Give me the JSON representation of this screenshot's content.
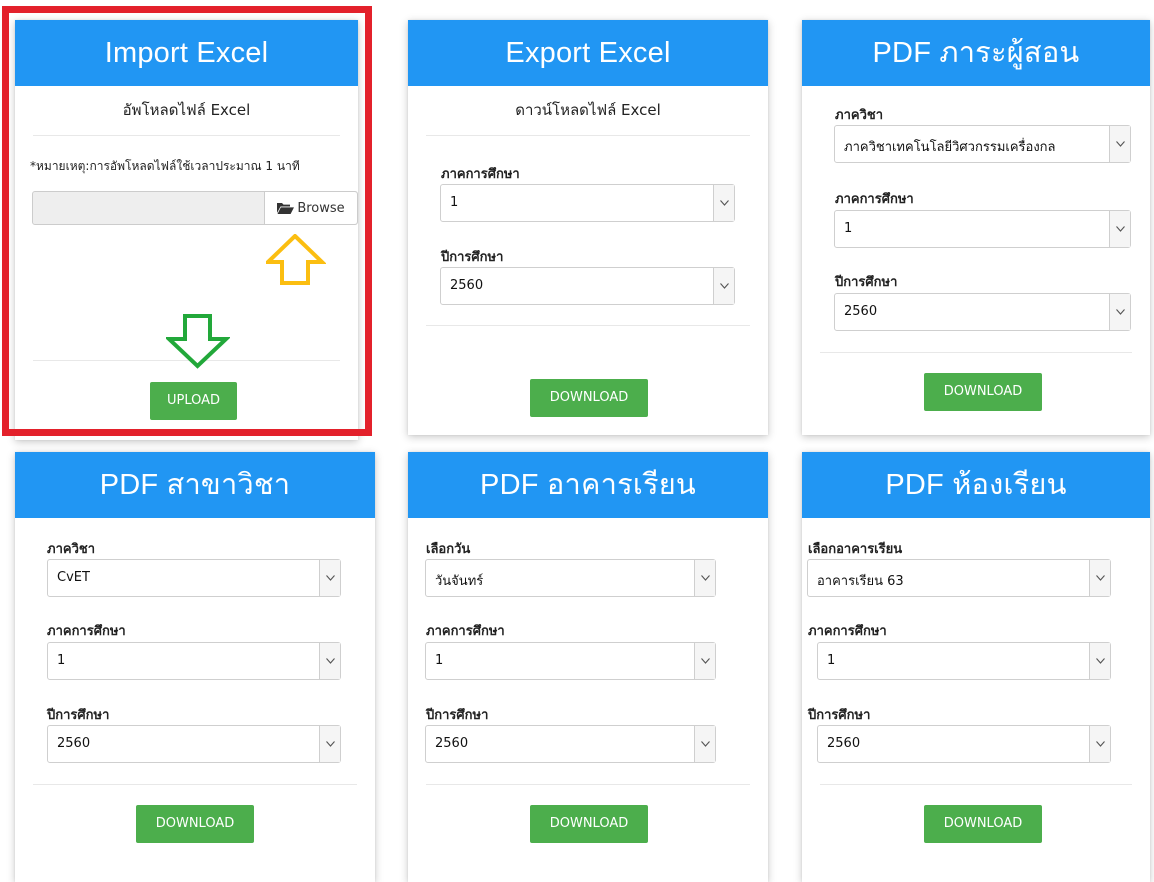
{
  "import_card": {
    "title": "Import Excel",
    "subtitle": "อัพโหลดไฟล์ Excel",
    "note": "*หมายเหตุ:การอัพโหลดไฟล์ใช้เวลาประมาณ 1 นาที",
    "browse_label": "Browse",
    "upload_label": "UPLOAD",
    "file_value": "",
    "highlight_color": "#e3212b",
    "arrow_up_color": "#fbbe11",
    "arrow_down_color": "#22a83a"
  },
  "export_card": {
    "title": "Export Excel",
    "subtitle": "ดาวน์โหลดไฟล์ Excel",
    "semester_label": "ภาคการศึกษา",
    "semester_value": "1",
    "year_label": "ปีการศึกษา",
    "year_value": "2560",
    "download_label": "DOWNLOAD"
  },
  "teaching_card": {
    "title": "PDF ภาระผู้สอน",
    "department_label": "ภาควิชา",
    "department_value": "ภาควิชาเทคโนโลยีวิศวกรรมเครื่องกล",
    "semester_label": "ภาคการศึกษา",
    "semester_value": "1",
    "year_label": "ปีการศึกษา",
    "year_value": "2560",
    "download_label": "DOWNLOAD"
  },
  "major_card": {
    "title": "PDF สาขาวิชา",
    "department_label": "ภาควิชา",
    "department_value": "CvET",
    "semester_label": "ภาคการศึกษา",
    "semester_value": "1",
    "year_label": "ปีการศึกษา",
    "year_value": "2560",
    "download_label": "DOWNLOAD"
  },
  "building_card": {
    "title": "PDF อาคารเรียน",
    "day_label": "เลือกวัน",
    "day_value": "วันจันทร์",
    "semester_label": "ภาคการศึกษา",
    "semester_value": "1",
    "year_label": "ปีการศึกษา",
    "year_value": "2560",
    "download_label": "DOWNLOAD"
  },
  "room_card": {
    "title": "PDF ห้องเรียน",
    "building_label": "เลือกอาคารเรียน",
    "building_value": "อาคารเรียน 63",
    "semester_label": "ภาคการศึกษา",
    "semester_value": "1",
    "year_label": "ปีการศึกษา",
    "year_value": "2560",
    "download_label": "DOWNLOAD"
  },
  "colors": {
    "header_blue": "#2196f3",
    "button_green": "#4cae4c"
  }
}
